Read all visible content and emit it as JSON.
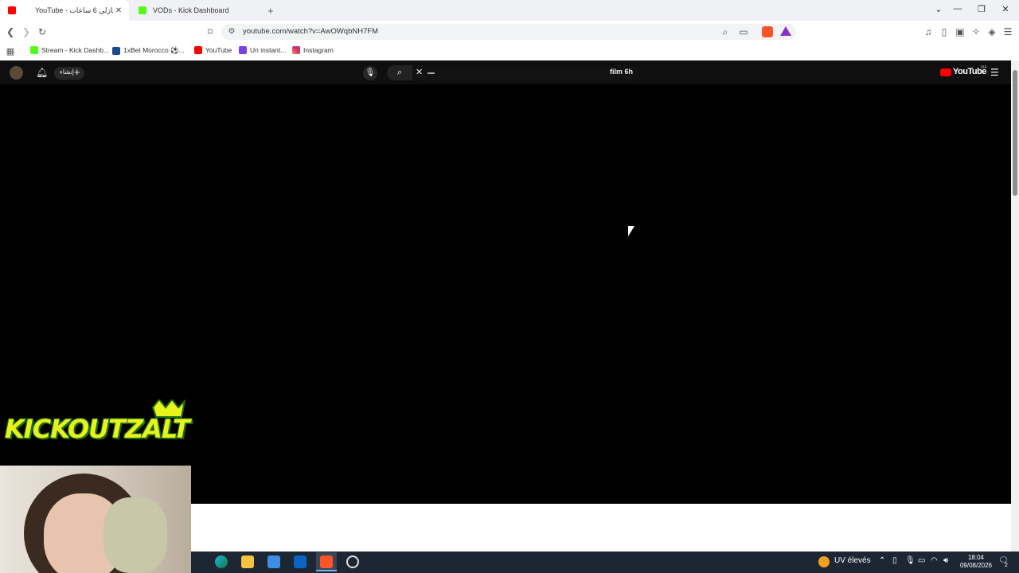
{
  "browser": {
    "tabs": [
      {
        "title": "YouTube - عد تنازلي 6 ساعات",
        "active": true,
        "favicon": "youtube-icon"
      },
      {
        "title": "VODs - Kick Dashboard",
        "active": false,
        "favicon": "kick-icon"
      }
    ],
    "new_tab_label": "+",
    "url": "youtube.com/watch?v=AwOWqbNH7FM",
    "bookmarks": [
      {
        "label": "Stream - Kick Dashb...",
        "icon": "kick-icon"
      },
      {
        "label": "1xBet Morocco ⚽...",
        "icon": "1xbet-icon"
      },
      {
        "label": "YouTube",
        "icon": "youtube-icon"
      },
      {
        "label": "Un instant...",
        "icon": "app-icon"
      },
      {
        "label": "Instagram",
        "icon": "instagram-icon"
      }
    ]
  },
  "youtube": {
    "create_label": "إنشاء",
    "search_query": "film 6h",
    "logo_text": "YouTube",
    "logo_sup": "MA"
  },
  "overlay": {
    "logo_text": "KICKOUTZALT"
  },
  "taskbar": {
    "weather_text": "UV élevés",
    "time": "18:04",
    "date": "09/08/2026",
    "notifications": "2"
  },
  "colors": {
    "youtube_red": "#ff0000",
    "kick_green": "#53fc18",
    "brave_orange": "#fb542b",
    "overlay_yellow": "#e8f21b"
  }
}
